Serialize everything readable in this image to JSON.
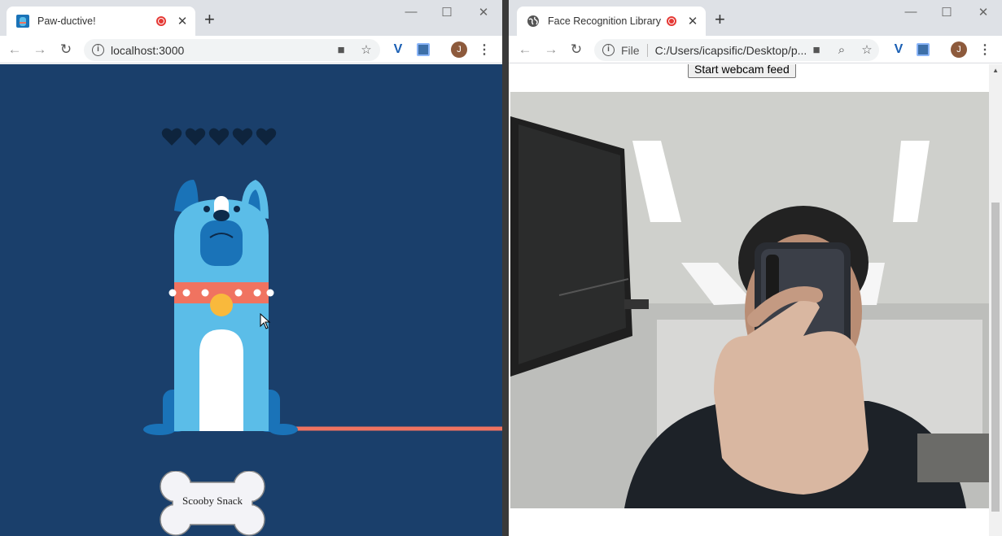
{
  "left_window": {
    "tab": {
      "title": "Paw-ductive!",
      "close": "✕"
    },
    "new_tab": "+",
    "controls": {
      "minimize": "—",
      "maximize": "☐",
      "close": "✕"
    },
    "nav": {
      "back": "←",
      "forward": "→",
      "reload": "↻"
    },
    "address": "localhost:3000",
    "avatar_letter": "J",
    "hearts_count": 5,
    "snack_button": "Scooby Snack",
    "colors": {
      "background": "#1a3f6b",
      "dog_body": "#5bbde8",
      "dog_dark": "#1a73b8",
      "collar": "#f07360",
      "tag": "#f9b93c",
      "leash": "#f07360"
    }
  },
  "right_window": {
    "tab": {
      "title": "Face Recognition Library",
      "close": "✕"
    },
    "new_tab": "+",
    "controls": {
      "minimize": "—",
      "maximize": "☐",
      "close": "✕"
    },
    "nav": {
      "back": "←",
      "forward": "→",
      "reload": "↻"
    },
    "address_prefix": "File",
    "address": "C:/Users/icapsific/Desktop/p...",
    "avatar_letter": "J",
    "start_button": "Start webcam feed"
  }
}
